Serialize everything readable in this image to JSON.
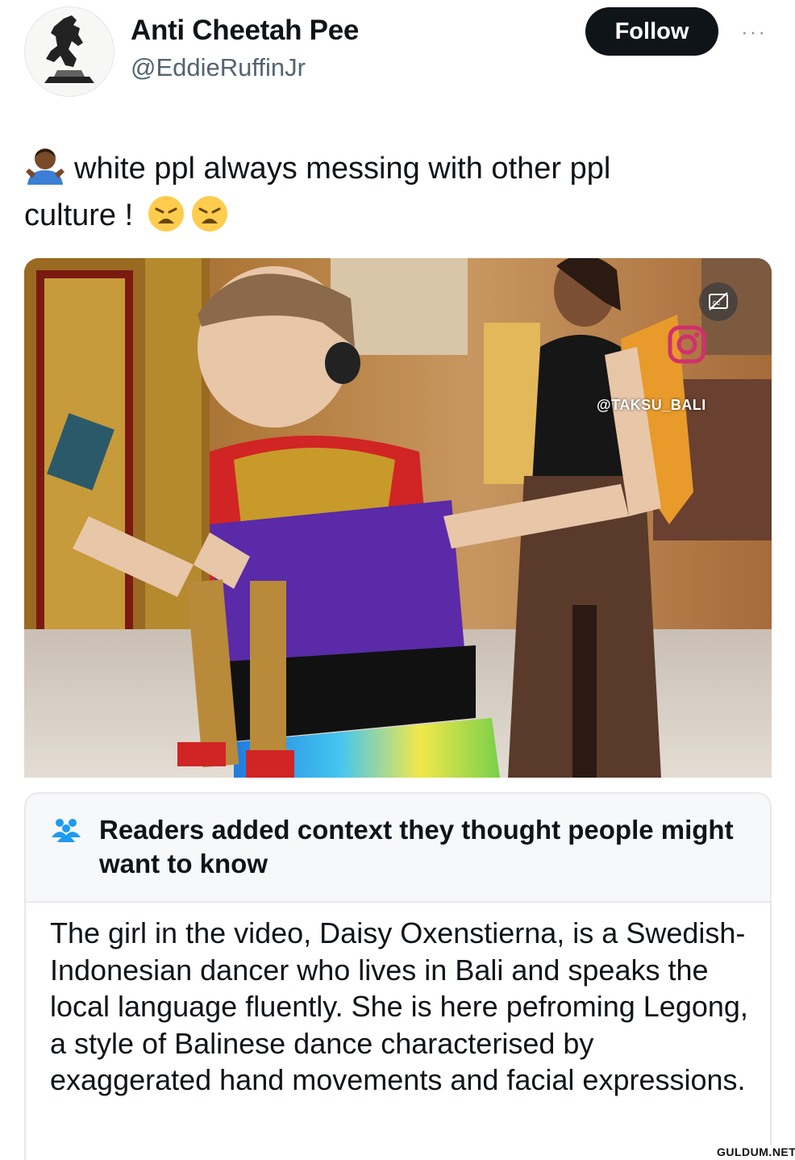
{
  "user": {
    "display_name": "Anti Cheetah Pee",
    "handle": "@EddieRuffinJr",
    "avatar_icon": "warrior-statue-avatar"
  },
  "actions": {
    "follow_label": "Follow",
    "more_label": "···"
  },
  "tweet": {
    "text_line1": "white ppl always messing with other ppl",
    "text_line2": "culture !",
    "emoji_lead": "person-shrugging-dark-skin-emoji",
    "emoji_trail": [
      "weary-face-emoji",
      "weary-face-emoji"
    ]
  },
  "media": {
    "type": "video",
    "watermark": "@TAKSU_BALI",
    "overlay_icons": [
      "captions-off-icon",
      "instagram-icon"
    ]
  },
  "community_note": {
    "title": "Readers added context they thought people might want to know",
    "body": "The girl in the video, Daisy Oxenstierna, is a Swedish-Indonesian dancer who lives in Bali and speaks the local language fluently. She is here pefroming Legong, a style of Balinese dance characterised by exaggerated hand movements and facial expressions.",
    "icon": "people-group-icon",
    "accent": "#1d9bf0"
  },
  "site_watermark": "GULDUM.NET"
}
